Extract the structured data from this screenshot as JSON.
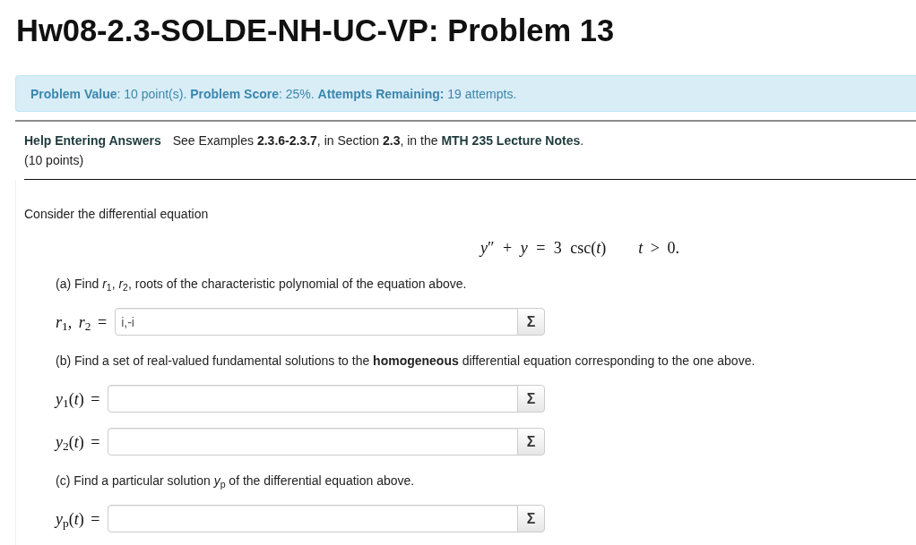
{
  "title": "Hw08-2.3-SOLDE-NH-UC-VP: Problem 13",
  "info_bar": {
    "text": "**Problem Value**: 10 point(s). **Problem Score**: 25%. **Attempts Remaining:** 19 attempts."
  },
  "help": {
    "link": "Help Entering Answers",
    "note": {
      "text": "See Examples **2.3.6-2.3.7**, in Section **2.3**, in the ",
      "link": "MTH 235 Lecture Notes",
      "end": "."
    },
    "points": "(10 points)"
  },
  "problem": {
    "intro": "Consider the differential equation",
    "equation": "*y*″ + *y* = 3 csc(*t*)",
    "condition": "*t* > 0.",
    "parts": [
      {
        "prompt": "(a) Find *r*$_{1}$, *r*$_{2}$, roots of the characteristic polynomial of the equation above.",
        "answers": [
          {
            "label": "*r*$_{1}$, *r*$_{2}$ =",
            "value": "i,-i",
            "button": "Σ"
          }
        ]
      },
      {
        "prompt": "(b) Find a set of real-valued fundamental solutions to the **homogeneous** differential equation corresponding to the one above.",
        "answers": [
          {
            "label": "*y*$_{1}$(*t*) =",
            "button": "Σ"
          },
          {
            "label": "*y*$_{2}$(*t*) =",
            "button": "Σ"
          }
        ]
      },
      {
        "prompt": "(c) Find a particular solution *y*$_{p}$ of the differential equation above.",
        "answers": [
          {
            "label": "*y*$_{p}$(*t*) =",
            "button": "Σ"
          }
        ]
      }
    ]
  }
}
